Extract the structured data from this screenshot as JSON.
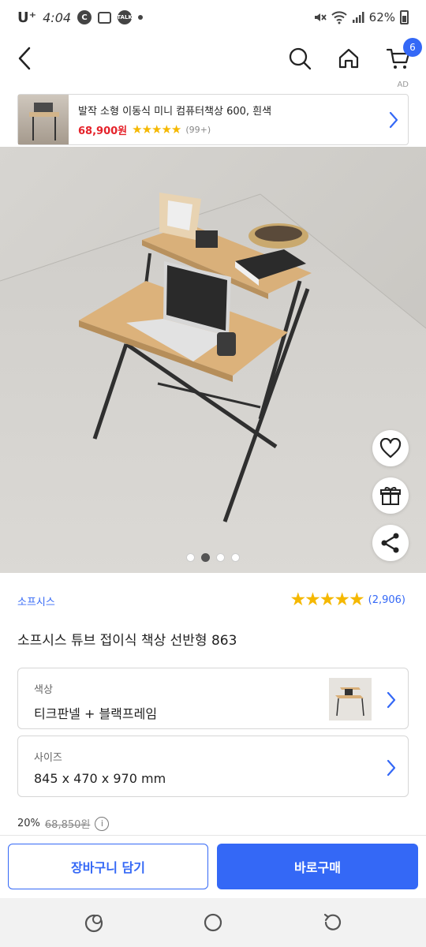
{
  "status_bar": {
    "carrier": "U⁺",
    "time": "4:04",
    "battery": "62%"
  },
  "header": {
    "cart_count": "6",
    "icons": [
      "back-icon",
      "search-icon",
      "home-icon",
      "cart-icon"
    ]
  },
  "ad": {
    "label": "AD",
    "title": "발작 소형 이동식 미니 컴퓨터책상 600, 흰색",
    "price": "68,900원",
    "stars": "★★★★★",
    "rating_count": "(99+)"
  },
  "gallery": {
    "image_count": 4,
    "active_index": 1
  },
  "product": {
    "brand": "소프시스",
    "stars": "★★★★★",
    "review_count": "(2,906)",
    "name": "소프시스 튜브 접이식 책상 선반형 863"
  },
  "options": {
    "color_label": "색상",
    "color_value": "티크판넬 + 블랙프레임",
    "size_label": "사이즈",
    "size_value": "845 x 470 x 970 mm"
  },
  "price": {
    "discount": "20%",
    "original": "68,850원",
    "info_symbol": "i"
  },
  "actions": {
    "add_to_cart": "장바구니 담기",
    "buy_now": "바로구매"
  },
  "colors": {
    "accent": "#3468f6",
    "star": "#f5b800",
    "sale": "#e5222a"
  }
}
